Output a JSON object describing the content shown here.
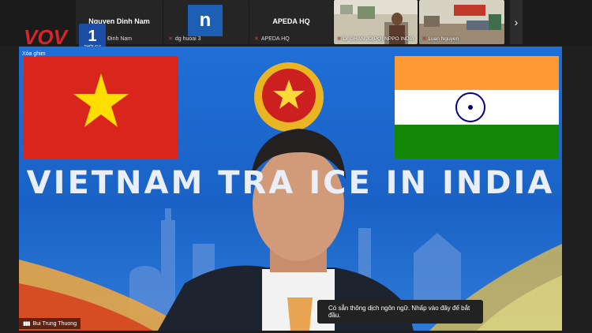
{
  "tiles": [
    {
      "name": "Nguyen Dinh Nam",
      "label": "Đinh Nam"
    },
    {
      "name": "",
      "label": "dg huoai 3"
    },
    {
      "name": "APEDA HQ",
      "label": "APEDA HQ"
    }
  ],
  "ntile_letter": "n",
  "video_tiles": [
    {
      "label": "Dr GHAN JD(PQ) NPPO INDIA"
    },
    {
      "label": "Luan Nguyen"
    }
  ],
  "logo": {
    "text": "VOV",
    "channel": "1",
    "sub": "THỜI SỰ"
  },
  "main": {
    "zoom_text": "Xóa ghim",
    "banner_text": "VIETNAM TRA      ICE IN INDIA",
    "speaker_name": "Bui Trung Thuong",
    "caption_prompt": "Có sẵn thông dịch ngôn ngữ. Nhấp vào đây để bắt đầu."
  },
  "icons": {
    "next": "chevron-right-icon",
    "mic": "mic-muted-icon",
    "signal": "signal-bars-icon"
  },
  "colors": {
    "vn_red": "#da251d",
    "vn_star": "#ffde00",
    "india_saffron": "#ff9933",
    "india_green": "#138808",
    "chakra": "#000080"
  }
}
